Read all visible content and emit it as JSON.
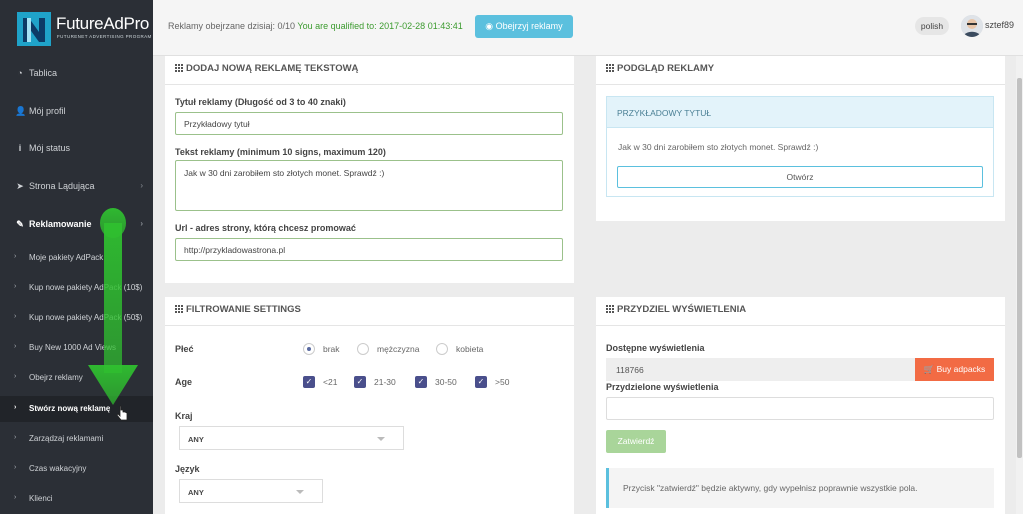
{
  "brand": {
    "name": "FutureAdPro",
    "tagline": "FUTURENET ADVERTISING PROGRAM",
    "color": "#1fa3c9"
  },
  "topbar": {
    "status_prefix": "Reklamy obejrzane dzisiaj: 0/10",
    "status_green": "You are qualified to: 2017-02-28 01:43:41",
    "watch_button": "Obejrzyj reklamy",
    "language": "polish",
    "username": "sztef89"
  },
  "sidebar": {
    "items": [
      {
        "label": "Tablica",
        "icon": "dashboard-icon"
      },
      {
        "label": "Mój profil",
        "icon": "user-icon"
      },
      {
        "label": "Mój status",
        "icon": "info-icon"
      },
      {
        "label": "Strona Lądująca",
        "icon": "paper-plane-icon"
      },
      {
        "label": "Reklamowanie",
        "icon": "magic-wand-icon"
      }
    ],
    "subitems": [
      "Moje pakiety AdPack",
      "Kup nowe pakiety AdPack (10$)",
      "Kup nowe pakiety AdPack (50$)",
      "Buy New 1000 Ad Views",
      "Obejrz reklamy",
      "Stwórz nową reklamę",
      "Zarządzaj reklamami",
      "Czas wakacyjny",
      "Klienci"
    ]
  },
  "add_ad": {
    "title": "DODAJ NOWĄ REKLAMĘ TEKSTOWĄ",
    "title_label": "Tytuł reklamy (Długość od 3 to 40 znaki)",
    "title_value": "Przykładowy tytuł",
    "text_label": "Tekst reklamy (minimum 10 signs, maximum 120)",
    "text_value": "Jak w 30 dni zarobiłem sto złotych monet. Sprawdź :)",
    "url_label": "Url - adres strony, którą chcesz promować",
    "url_value": "http://przykladowastrona.pl"
  },
  "preview": {
    "title": "PODGLĄD REKLAMY",
    "ad_title": "PRZYKŁADOWY TYTUŁ",
    "ad_text": "Jak w 30 dni zarobiłem sto złotych monet. Sprawdź :)",
    "open_button": "Otwórz"
  },
  "filter": {
    "title": "FILTROWANIE SETTINGS",
    "gender_label": "Płeć",
    "gender_options": [
      "brak",
      "mężczyzna",
      "kobieta"
    ],
    "age_label": "Age",
    "age_options": [
      "<21",
      "21-30",
      "30-50",
      ">50"
    ],
    "country_label": "Kraj",
    "country_value": "ANY",
    "lang_label": "Język",
    "lang_value": "ANY"
  },
  "views": {
    "title": "PRZYDZIEL WYŚWIETLENIA",
    "available_label": "Dostępne wyświetlenia",
    "available_value": "118766",
    "buy_button": "Buy adpacks",
    "assigned_label": "Przydzielone wyświetlenia",
    "confirm_button": "Zatwierdź",
    "note": "Przycisk \"zatwierdź\" będzie aktywny, gdy wypełnisz poprawnie wszystkie pola."
  },
  "colors": {
    "sidebar": "#2b2f36",
    "accent_blue": "#5bc0de",
    "buy_orange": "#f26b44",
    "confirm_green": "#a9d59a",
    "qualified_green": "#3c9b2f"
  }
}
